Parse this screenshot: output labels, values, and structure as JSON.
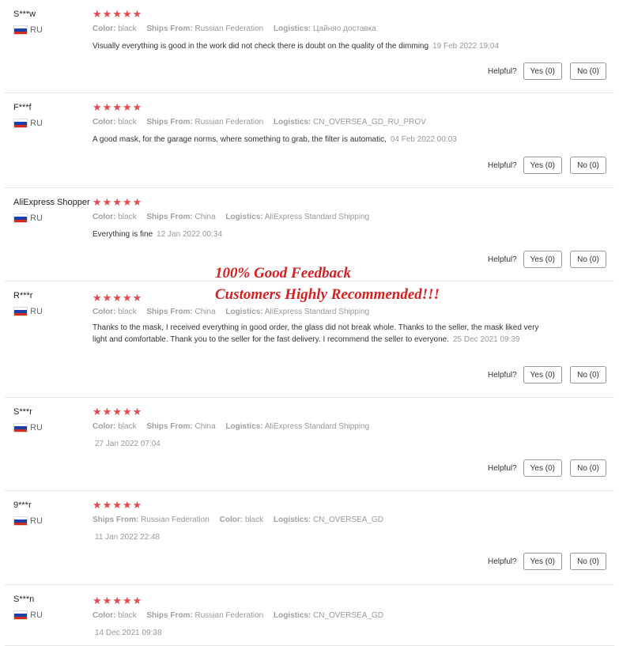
{
  "helpful_label": "Helpful?",
  "colors": {
    "star": "#e7484b",
    "promo": "#d62020"
  },
  "promo": {
    "line1": "100% Good Feedback",
    "line2": "Customers Highly Recommended!!!"
  },
  "reviews": [
    {
      "user": "S***w",
      "country": "RU",
      "stars": 5,
      "meta": [
        {
          "k": "Color:",
          "v": "black"
        },
        {
          "k": "Ships From:",
          "v": "Russian Federation"
        },
        {
          "k": "Logistics:",
          "v": "Цайняо доставка"
        }
      ],
      "text": "Visually everything is good in the work did not check there is doubt on the quality of the dimming",
      "date": "19 Feb 2022 19:04",
      "yes": "Yes (0)",
      "no": "No (0)"
    },
    {
      "user": "F***f",
      "country": "RU",
      "stars": 5,
      "meta": [
        {
          "k": "Color:",
          "v": "black"
        },
        {
          "k": "Ships From:",
          "v": "Russian Federation"
        },
        {
          "k": "Logistics:",
          "v": "CN_OVERSEA_GD_RU_PROV"
        }
      ],
      "text": "A good mask, for the garage norms, where something to grab, the filter is automatic,",
      "date": "04 Feb 2022 00:03",
      "yes": "Yes (0)",
      "no": "No (0)"
    },
    {
      "user": "AliExpress Shopper",
      "country": "RU",
      "stars": 5,
      "meta": [
        {
          "k": "Color:",
          "v": "black"
        },
        {
          "k": "Ships From:",
          "v": "China"
        },
        {
          "k": "Logistics:",
          "v": "AliExpress Standard Shipping"
        }
      ],
      "text": "Everything is fine",
      "date": "12 Jan 2022 00:34",
      "yes": "Yes (0)",
      "no": "No (0)"
    },
    {
      "user": "R***r",
      "country": "RU",
      "stars": 5,
      "meta": [
        {
          "k": "Color:",
          "v": "black"
        },
        {
          "k": "Ships From:",
          "v": "China"
        },
        {
          "k": "Logistics:",
          "v": "AliExpress Standard Shipping"
        }
      ],
      "text": "Thanks to the mask, I received everything in good order, the glass did not break whole. Thanks to the seller, the mask liked very light and comfortable. Thank you to the seller for the fast delivery. I recommend the seller to everyone.",
      "date": "25 Dec 2021 09:39",
      "yes": "Yes (0)",
      "no": "No (0)"
    },
    {
      "user": "S***r",
      "country": "RU",
      "stars": 5,
      "meta": [
        {
          "k": "Color:",
          "v": "black"
        },
        {
          "k": "Ships From:",
          "v": "China"
        },
        {
          "k": "Logistics:",
          "v": "AliExpress Standard Shipping"
        }
      ],
      "text": "",
      "date": "27 Jan 2022 07:04",
      "yes": "Yes (0)",
      "no": "No (0)"
    },
    {
      "user": "9***r",
      "country": "RU",
      "stars": 5,
      "meta": [
        {
          "k": "Ships From:",
          "v": "Russian Federation"
        },
        {
          "k": "Color:",
          "v": "black"
        },
        {
          "k": "Logistics:",
          "v": "CN_OVERSEA_GD"
        }
      ],
      "text": "",
      "date": "11 Jan 2022 22:48",
      "yes": "Yes (0)",
      "no": "No (0)"
    },
    {
      "user": "S***n",
      "country": "RU",
      "stars": 5,
      "meta": [
        {
          "k": "Color:",
          "v": "black"
        },
        {
          "k": "Ships From:",
          "v": "Russian Federation"
        },
        {
          "k": "Logistics:",
          "v": "CN_OVERSEA_GD"
        }
      ],
      "text": "",
      "date": "14 Dec 2021 09:38",
      "yes": "",
      "no": ""
    }
  ]
}
